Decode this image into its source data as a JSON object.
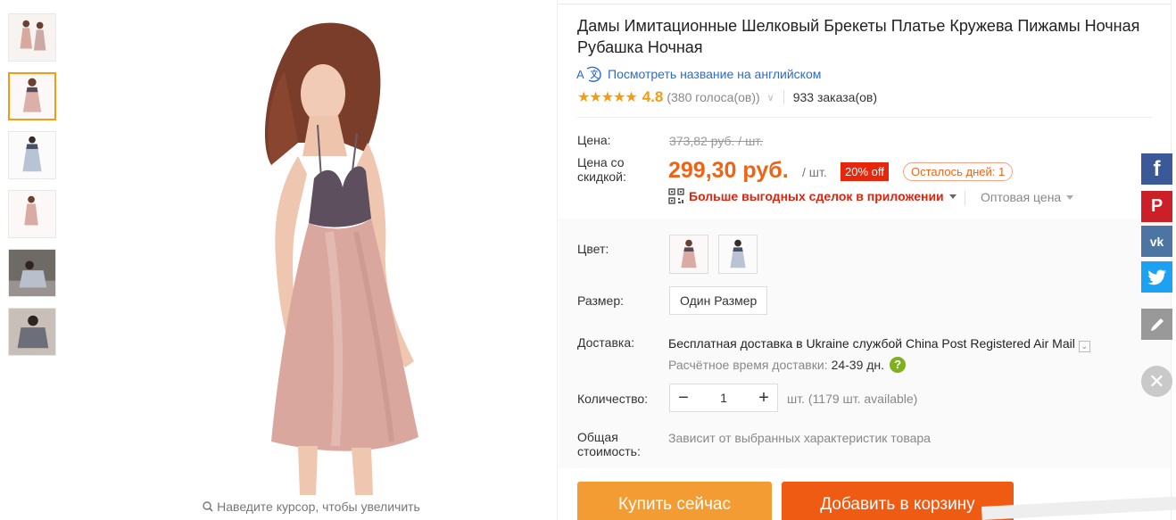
{
  "gallery": {
    "thumbnails": [
      "thumb-1",
      "thumb-2",
      "thumb-3",
      "thumb-4",
      "thumb-5",
      "thumb-6"
    ],
    "active_index": 1,
    "zoom_hint": "Наведите курсор, чтобы увеличить"
  },
  "product": {
    "title": "Дамы Имитационные Шелковый Брекеты Платье Кружева Пижамы Ночная Рубашка Ночная",
    "translate_link": "Посмотреть название на английском",
    "stars": "★★★★★",
    "rating": "4.8",
    "votes": "(380 голоса(ов))",
    "orders": "933 заказа(ов)"
  },
  "price": {
    "price_label": "Цена:",
    "old_price": "373,82 руб. / шт.",
    "discount_label_line1": "Цена со",
    "discount_label_line2": "скидкой:",
    "new_price": "299,30 руб.",
    "per_unit": "/ шт.",
    "discount_badge": "20% off",
    "days_left": "Осталось дней: 1",
    "app_deals": "Больше выгодных сделок в приложении",
    "wholesale": "Оптовая цена"
  },
  "options": {
    "color_label": "Цвет:",
    "size_label": "Размер:",
    "size_value": "Один Размер",
    "shipping_label": "Доставка:",
    "shipping_text": "Бесплатная доставка в Ukraine службой China Post Registered Air Mail",
    "eta_label": "Расчётное время доставки:",
    "eta_value": "24-39 дн.",
    "quantity_label": "Количество:",
    "quantity_value": "1",
    "quantity_note": "шт. (1179 шт. available)",
    "total_label_line1": "Общая",
    "total_label_line2": "стоимость:",
    "total_note": "Зависит от выбранных характеристик товара"
  },
  "actions": {
    "buy_now": "Купить сейчас",
    "add_to_cart": "Добавить в корзину"
  },
  "social": {
    "facebook": "f",
    "pinterest": "P",
    "vk": "vk"
  },
  "colors": {
    "accent_orange": "#f06315",
    "buy_button": "#f39c33",
    "cart_button": "#f05b13",
    "link_blue": "#2a6bd0",
    "star": "#f39c12"
  }
}
